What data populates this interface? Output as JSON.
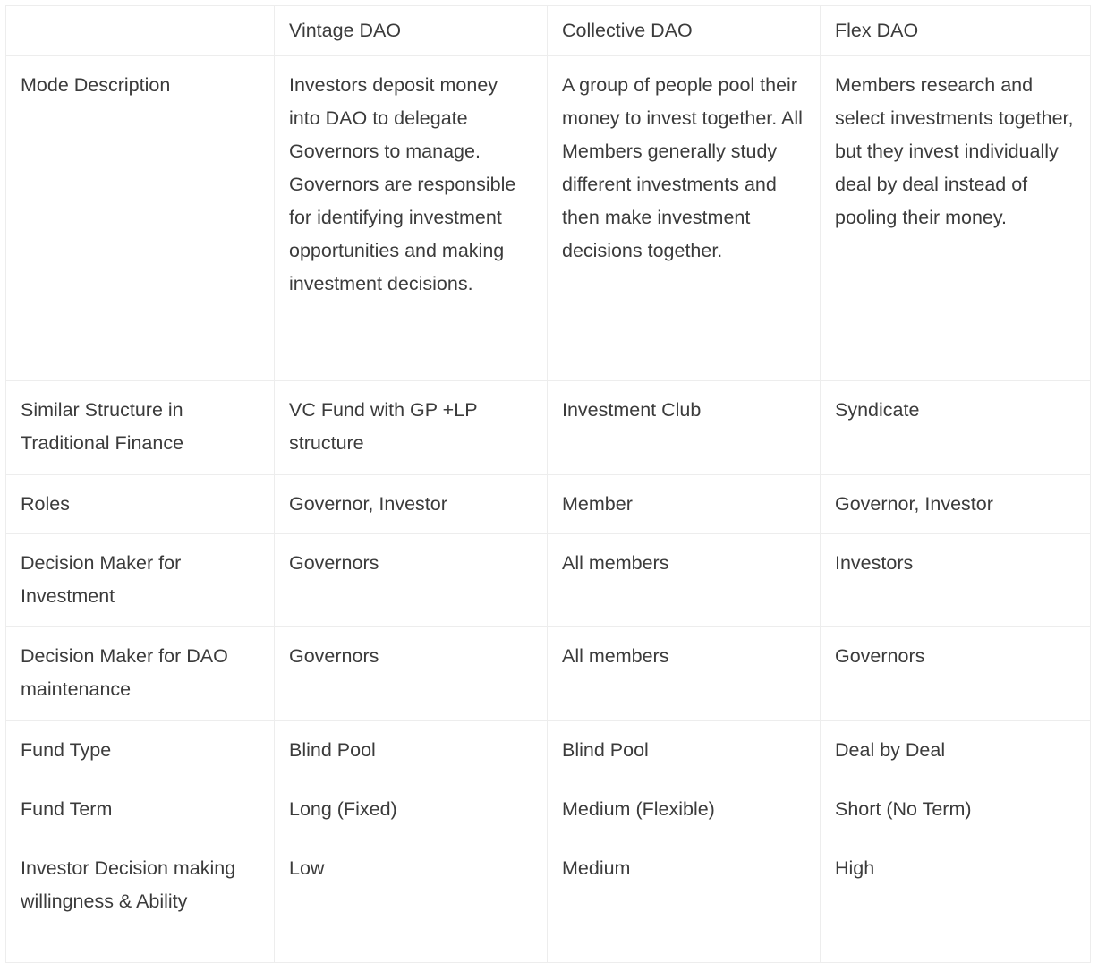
{
  "table": {
    "columns": [
      {
        "key": "attribute",
        "label": ""
      },
      {
        "key": "vintage",
        "label": "Vintage DAO"
      },
      {
        "key": "collective",
        "label": "Collective DAO"
      },
      {
        "key": "flex",
        "label": "Flex DAO"
      }
    ],
    "rows": [
      {
        "id": "mode-description",
        "attribute": "Mode Description",
        "vintage": "Investors deposit money into DAO to delegate Governors to manage. Governors are responsible for identifying investment opportunities and making investment decisions.",
        "collective": "A group of people pool their money to invest together. All Members generally study different investments and then make investment decisions together.",
        "flex": "Members research and select investments together, but they invest individually deal by deal instead of pooling their money."
      },
      {
        "id": "similar-structure",
        "attribute": "Similar Structure in Traditional Finance",
        "vintage": "VC Fund with GP +LP structure",
        "collective": "Investment Club",
        "flex": "Syndicate"
      },
      {
        "id": "roles",
        "attribute": "Roles",
        "vintage": "Governor, Investor",
        "collective": "Member",
        "flex": "Governor, Investor"
      },
      {
        "id": "decision-maker-investment",
        "attribute": "Decision Maker for Investment",
        "vintage": "Governors",
        "collective": "All members",
        "flex": "Investors"
      },
      {
        "id": "decision-maker-dao-maintenance",
        "attribute": "Decision Maker for DAO maintenance",
        "vintage": "Governors",
        "collective": "All members",
        "flex": "Governors"
      },
      {
        "id": "fund-type",
        "attribute": "Fund Type",
        "vintage": "Blind Pool",
        "collective": "Blind Pool",
        "flex": "Deal by Deal"
      },
      {
        "id": "fund-term",
        "attribute": "Fund Term",
        "vintage": "Long (Fixed)",
        "collective": "Medium (Flexible)",
        "flex": "Short (No Term)"
      },
      {
        "id": "investor-decision-making",
        "attribute": "Investor Decision making willingness & Ability",
        "vintage": "Low",
        "collective": "Medium",
        "flex": "High"
      }
    ]
  },
  "style": {
    "text_color": "#3b3b3b",
    "border_color": "#ededed",
    "background_color": "#ffffff"
  }
}
